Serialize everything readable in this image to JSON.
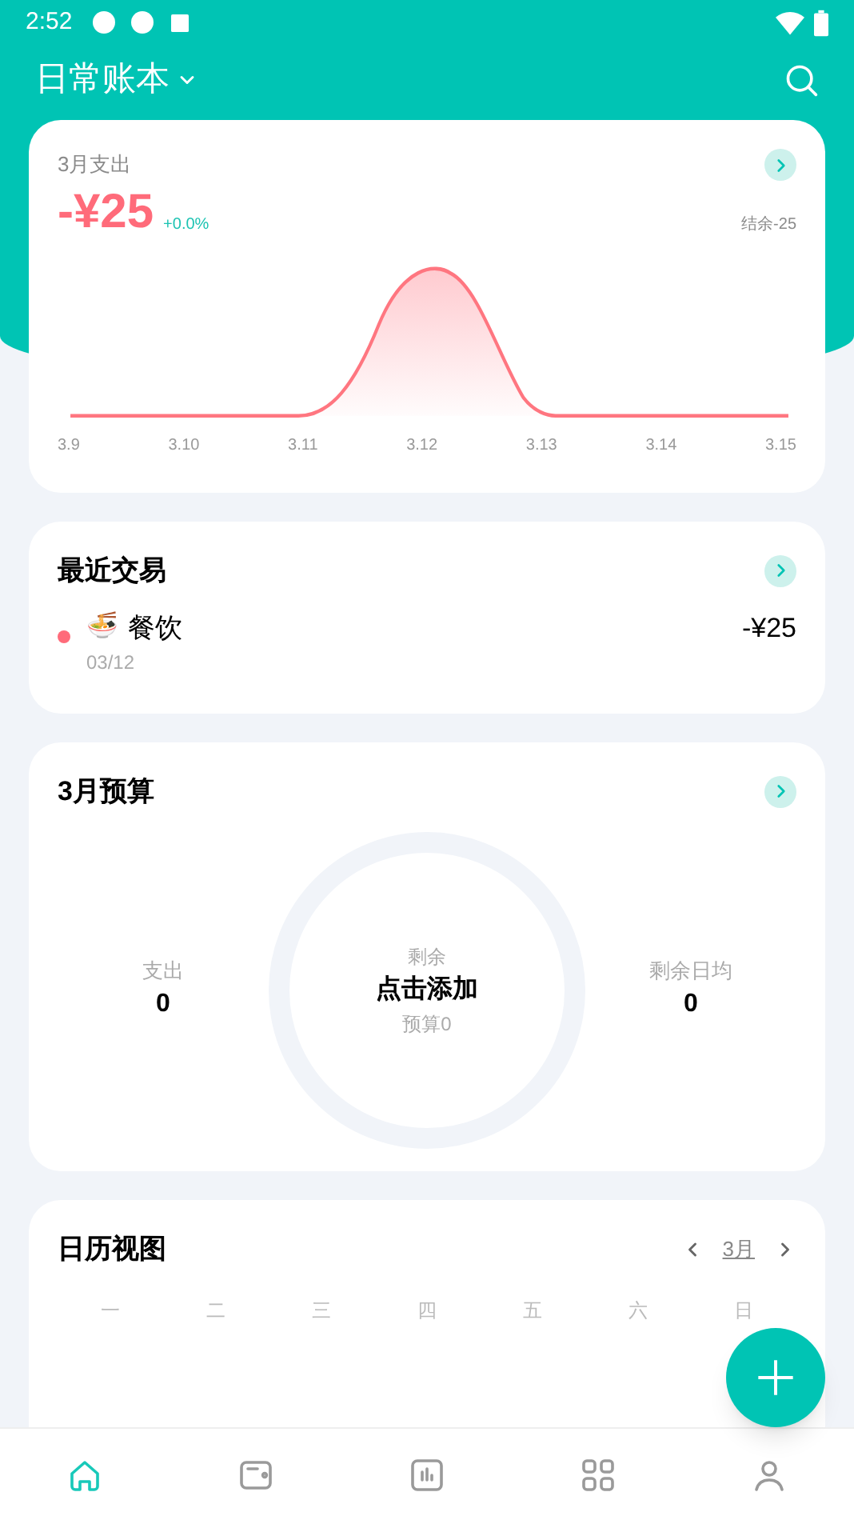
{
  "status_bar": {
    "time": "2:52"
  },
  "header": {
    "title": "日常账本"
  },
  "expense_card": {
    "title": "3月支出",
    "amount": "-¥25",
    "change": "+0.0%",
    "balance": "结余-25",
    "x_labels": [
      "3.9",
      "3.10",
      "3.11",
      "3.12",
      "3.13",
      "3.14",
      "3.15"
    ]
  },
  "recent": {
    "title": "最近交易",
    "items": [
      {
        "color": "#ff6b7a",
        "emoji": "🍜",
        "category": "餐饮",
        "date": "03/12",
        "amount": "-¥25"
      }
    ]
  },
  "budget": {
    "title": "3月预算",
    "left": {
      "label": "支出",
      "value": "0"
    },
    "center": {
      "label": "剩余",
      "action": "点击添加",
      "sub": "预算0"
    },
    "right": {
      "label": "剩余日均",
      "value": "0"
    }
  },
  "calendar": {
    "title": "日历视图",
    "month": "3月",
    "weekdays": [
      "一",
      "二",
      "三",
      "四",
      "五",
      "六",
      "日"
    ]
  },
  "nav": [
    {
      "kind": "home",
      "selected": true
    },
    {
      "kind": "wallet",
      "selected": false
    },
    {
      "kind": "chart",
      "selected": false
    },
    {
      "kind": "grid",
      "selected": false
    },
    {
      "kind": "person",
      "selected": false
    }
  ]
}
